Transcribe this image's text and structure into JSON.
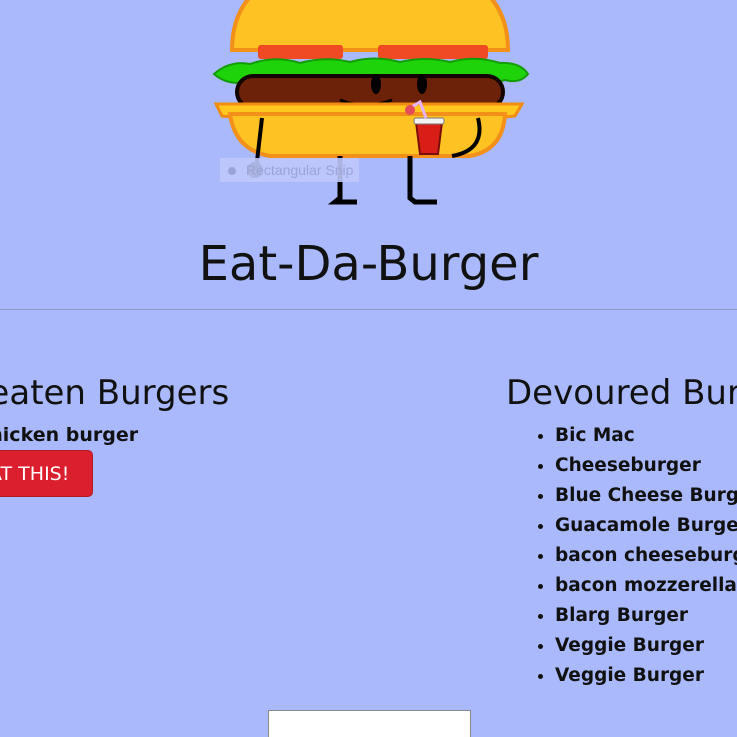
{
  "header": {
    "title": "Eat-Da-Burger",
    "snip_overlay_label": "Rectangular Snip"
  },
  "uneaten": {
    "heading": "Uneaten Burgers",
    "items": [
      {
        "name": "chicken burger",
        "button_label": "EAT THIS!"
      }
    ]
  },
  "devoured": {
    "heading": "Devoured Burgers",
    "items": [
      "Bic Mac",
      "Cheeseburger",
      "Blue Cheese Burger",
      "Guacamole Burger",
      "bacon cheeseburger",
      "bacon mozzerella burger",
      "Blarg Burger",
      "Veggie Burger",
      "Veggie Burger"
    ]
  },
  "form": {
    "burger_input_value": ""
  },
  "colors": {
    "background": "#aab9fb",
    "eat_button": "#dc1f2e"
  },
  "icons": {
    "mascot": "burger-mascot-icon"
  }
}
